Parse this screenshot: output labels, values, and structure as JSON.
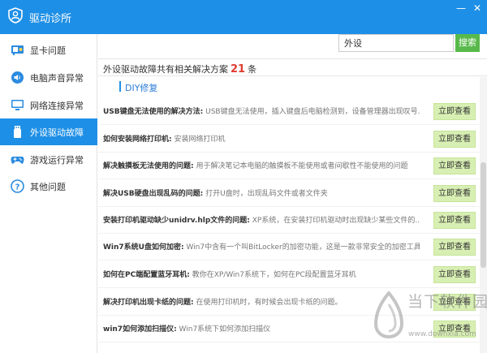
{
  "window": {
    "title": "驱动诊所",
    "minimize": "—",
    "close": "✕"
  },
  "sidebar": {
    "items": [
      {
        "label": "显卡问题",
        "icon": "graphics-card-icon"
      },
      {
        "label": "电脑声音异常",
        "icon": "speaker-icon"
      },
      {
        "label": "网络连接异常",
        "icon": "monitor-icon"
      },
      {
        "label": "外设驱动故障",
        "icon": "usb-drive-icon",
        "active": true
      },
      {
        "label": "游戏运行异常",
        "icon": "gamepad-icon"
      },
      {
        "label": "其他问题",
        "icon": "question-icon"
      }
    ]
  },
  "search": {
    "value": "外设",
    "button": "搜索"
  },
  "results": {
    "prefix": "外设驱动故障共有相关解决方案",
    "count": "21",
    "suffix": "条"
  },
  "section": {
    "label": "DIY修复"
  },
  "list": [
    {
      "title": "USB键盘无法使用的解决方法:",
      "desc": "USB键盘无法使用，插入键盘后电脑检测到，设备管理器出现叹号...",
      "button": "立即查看"
    },
    {
      "title": "如何安装网络打印机:",
      "desc": "安装网络打印机",
      "button": "立即查看"
    },
    {
      "title": "解决触摸板无法使用的问题:",
      "desc": "用于解决笔记本电脑的触摸板不能使用或者间歇性不能使用的问题",
      "button": "立即查看"
    },
    {
      "title": "解决USB硬盘出现乱码的问题:",
      "desc": "打开U盘时，出现乱码文件或者文件夹",
      "button": "立即查看"
    },
    {
      "title": "安装打印机驱动缺少unidrv.hlp文件的问题:",
      "desc": "XP系统，在安装打印机驱动时出现缺少某些文件的...",
      "button": "立即查看"
    },
    {
      "title": "Win7系统U盘如何加密:",
      "desc": "Win7中含有一个叫BitLocker的加密功能，这是一款非常安全的加密工具，...",
      "button": "立即查看"
    },
    {
      "title": "如何在PC端配置蓝牙耳机:",
      "desc": "教你在XP/Win7系统下，如何在PC段配置蓝牙耳机",
      "button": "立即查看"
    },
    {
      "title": "解决打印机出现卡纸的问题:",
      "desc": "在使用打印机时，有时候会出现卡纸的问题。",
      "button": "立即查看"
    },
    {
      "title": "win7如何添加扫描仪:",
      "desc": "Win7系统下如何添加扫描仪",
      "button": "立即查看"
    }
  ],
  "watermark": {
    "text": "当下软件园",
    "url": "www.downxia.com"
  },
  "colors": {
    "accent": "#1e8fe6",
    "count": "#e03c31",
    "button_bg": "#d8efb3",
    "search_button": "#58b94b"
  }
}
